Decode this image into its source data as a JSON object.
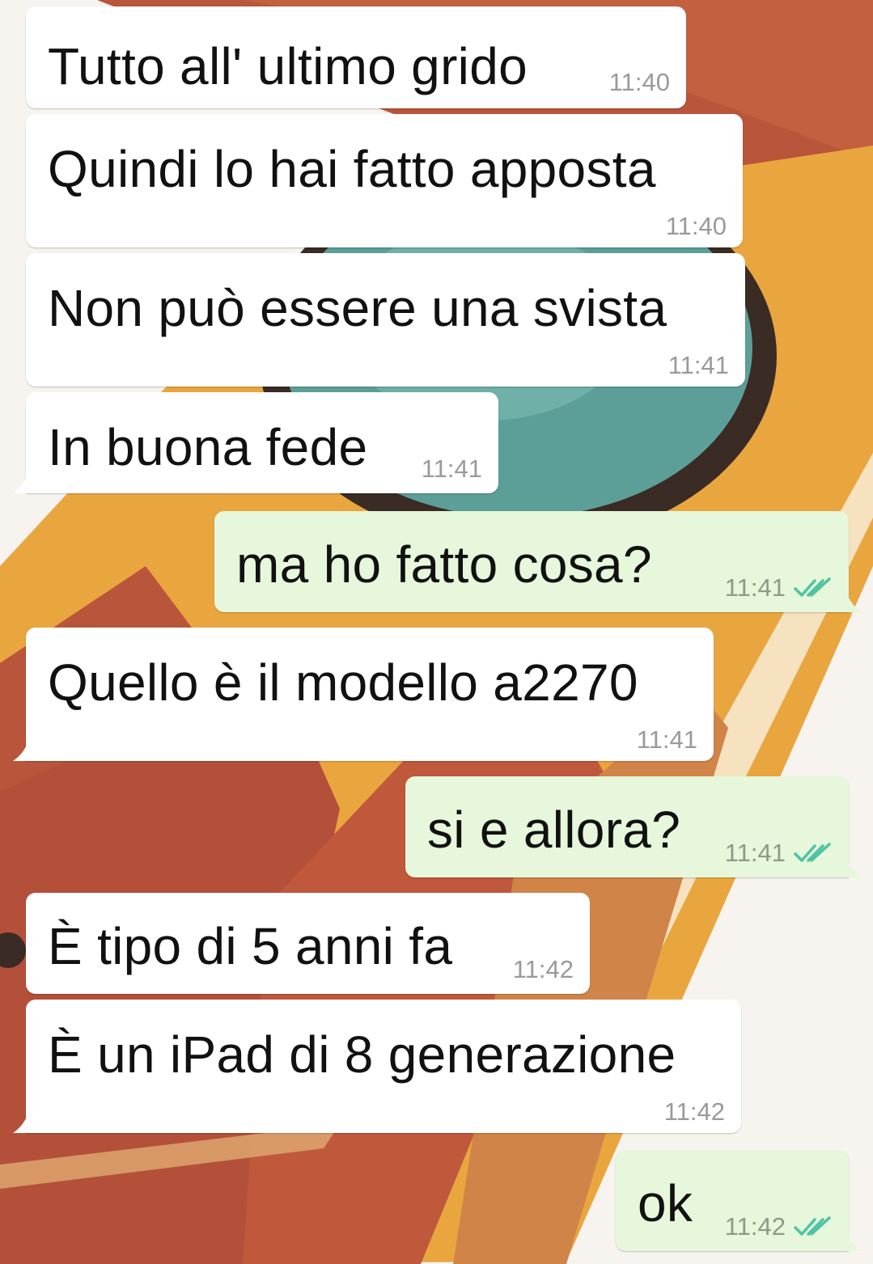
{
  "messages": [
    {
      "direction": "in",
      "text": "Tutto all' ultimo grido",
      "time": "11:40",
      "tail": false
    },
    {
      "direction": "in",
      "text": "Quindi lo hai fatto apposta",
      "time": "11:40",
      "tail": false
    },
    {
      "direction": "in",
      "text": "Non può essere una svista",
      "time": "11:41",
      "tail": false
    },
    {
      "direction": "in",
      "text": "In buona fede",
      "time": "11:41",
      "tail": true
    },
    {
      "direction": "out",
      "text": "ma ho fatto cosa?",
      "time": "11:41",
      "status": "double-check-read",
      "tail": true
    },
    {
      "direction": "in",
      "text": "Quello è il modello a2270",
      "time": "11:41",
      "tail": true
    },
    {
      "direction": "out",
      "text": "si e allora?",
      "time": "11:41",
      "status": "double-check-read",
      "tail": true
    },
    {
      "direction": "in",
      "text": "È tipo di 5 anni fa",
      "time": "11:42",
      "tail": false
    },
    {
      "direction": "in",
      "text": "È un iPad di 8 generazione",
      "time": "11:42",
      "tail": true
    },
    {
      "direction": "out",
      "text": "ok",
      "time": "11:42",
      "status": "double-check-read",
      "tail": true
    }
  ],
  "colors": {
    "incoming_bubble": "#ffffff",
    "outgoing_bubble": "#e6f7db",
    "read_ticks": "#4fc3a1",
    "wallpaper_orange": "#e8a23b",
    "wallpaper_red": "#b54a32",
    "wallpaper_teal": "#5b9e96"
  },
  "icons": {
    "read_status": "double-check-icon"
  }
}
